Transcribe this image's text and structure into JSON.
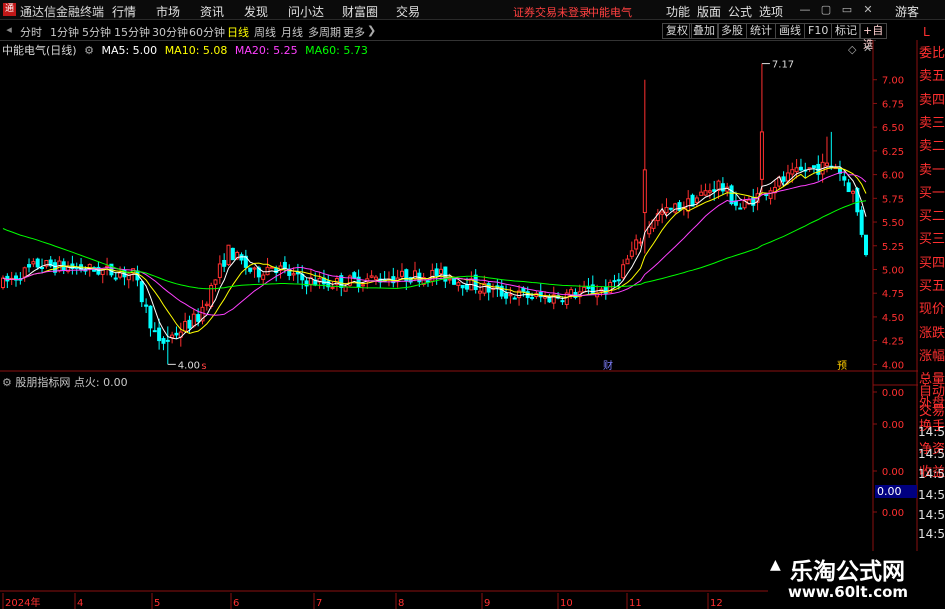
{
  "titlebar": {
    "app_title": "通达信金融终端",
    "menus": [
      "行情",
      "市场",
      "资讯",
      "发现",
      "问小达",
      "财富圈",
      "交易"
    ],
    "login_status": "证券交易未登录",
    "stock_name": "中能电气",
    "right_menus": [
      "功能",
      "版面",
      "公式",
      "选项"
    ],
    "guest": "游客"
  },
  "periods": {
    "items": [
      "分时",
      "1分钟",
      "5分钟",
      "15分钟",
      "30分钟",
      "60分钟",
      "日线",
      "周线",
      "月线",
      "多周期",
      "更多"
    ],
    "active": "日线"
  },
  "tools": [
    "复权",
    "叠加",
    "多股",
    "统计",
    "画线",
    "F10",
    "标记",
    "+自选"
  ],
  "tool_L": "L",
  "indicator": {
    "stock": "中能电气(日线)",
    "ma5": "MA5: 5.00",
    "ma10": "MA10: 5.08",
    "ma20": "MA20: 5.25",
    "ma60": "MA60: 5.73"
  },
  "sub_indicator": {
    "name": "股朋指标网",
    "value": "点火: 0.00"
  },
  "side_labels": [
    "委比",
    "卖五",
    "卖四",
    "卖三",
    "卖二",
    "卖一",
    "买一",
    "买二",
    "买三",
    "买四",
    "买五",
    "现价",
    "涨跌",
    "涨幅",
    "总量",
    "外盘",
    "换手",
    "净资",
    "收益",
    "自动",
    "交易"
  ],
  "side_times": [
    "14:56",
    "14:56",
    "14:56",
    "14:56",
    "14:56",
    "14:56"
  ],
  "sub_value_box": "0.00",
  "watermark": {
    "title": "乐淘公式网",
    "url": "www.60lt.com"
  },
  "colors": {
    "up": "#ff3030",
    "down": "#00ffff",
    "ma5": "#ffffff",
    "ma10": "#ffff00",
    "ma20": "#ff40ff",
    "ma60": "#00ff00"
  },
  "chart_data": {
    "type": "candlestick",
    "y_ticks": [
      "7.00",
      "6.75",
      "6.50",
      "6.25",
      "6.00",
      "5.75",
      "5.50",
      "5.25",
      "5.00",
      "4.75",
      "4.50",
      "4.25",
      "4.00"
    ],
    "sub_y_ticks": [
      "0.00",
      "0.00",
      "0.00",
      "0.00"
    ],
    "x_ticks": [
      "2024年",
      "4",
      "5",
      "6",
      "7",
      "8",
      "9",
      "10",
      "11",
      "12"
    ],
    "annotations": {
      "high": "7.17",
      "low": "4.00"
    },
    "event_markers": [
      "s",
      "财",
      "预"
    ],
    "ma_values": {
      "MA5": 5.0,
      "MA10": 5.08,
      "MA20": 5.25,
      "MA60": 5.73
    }
  }
}
